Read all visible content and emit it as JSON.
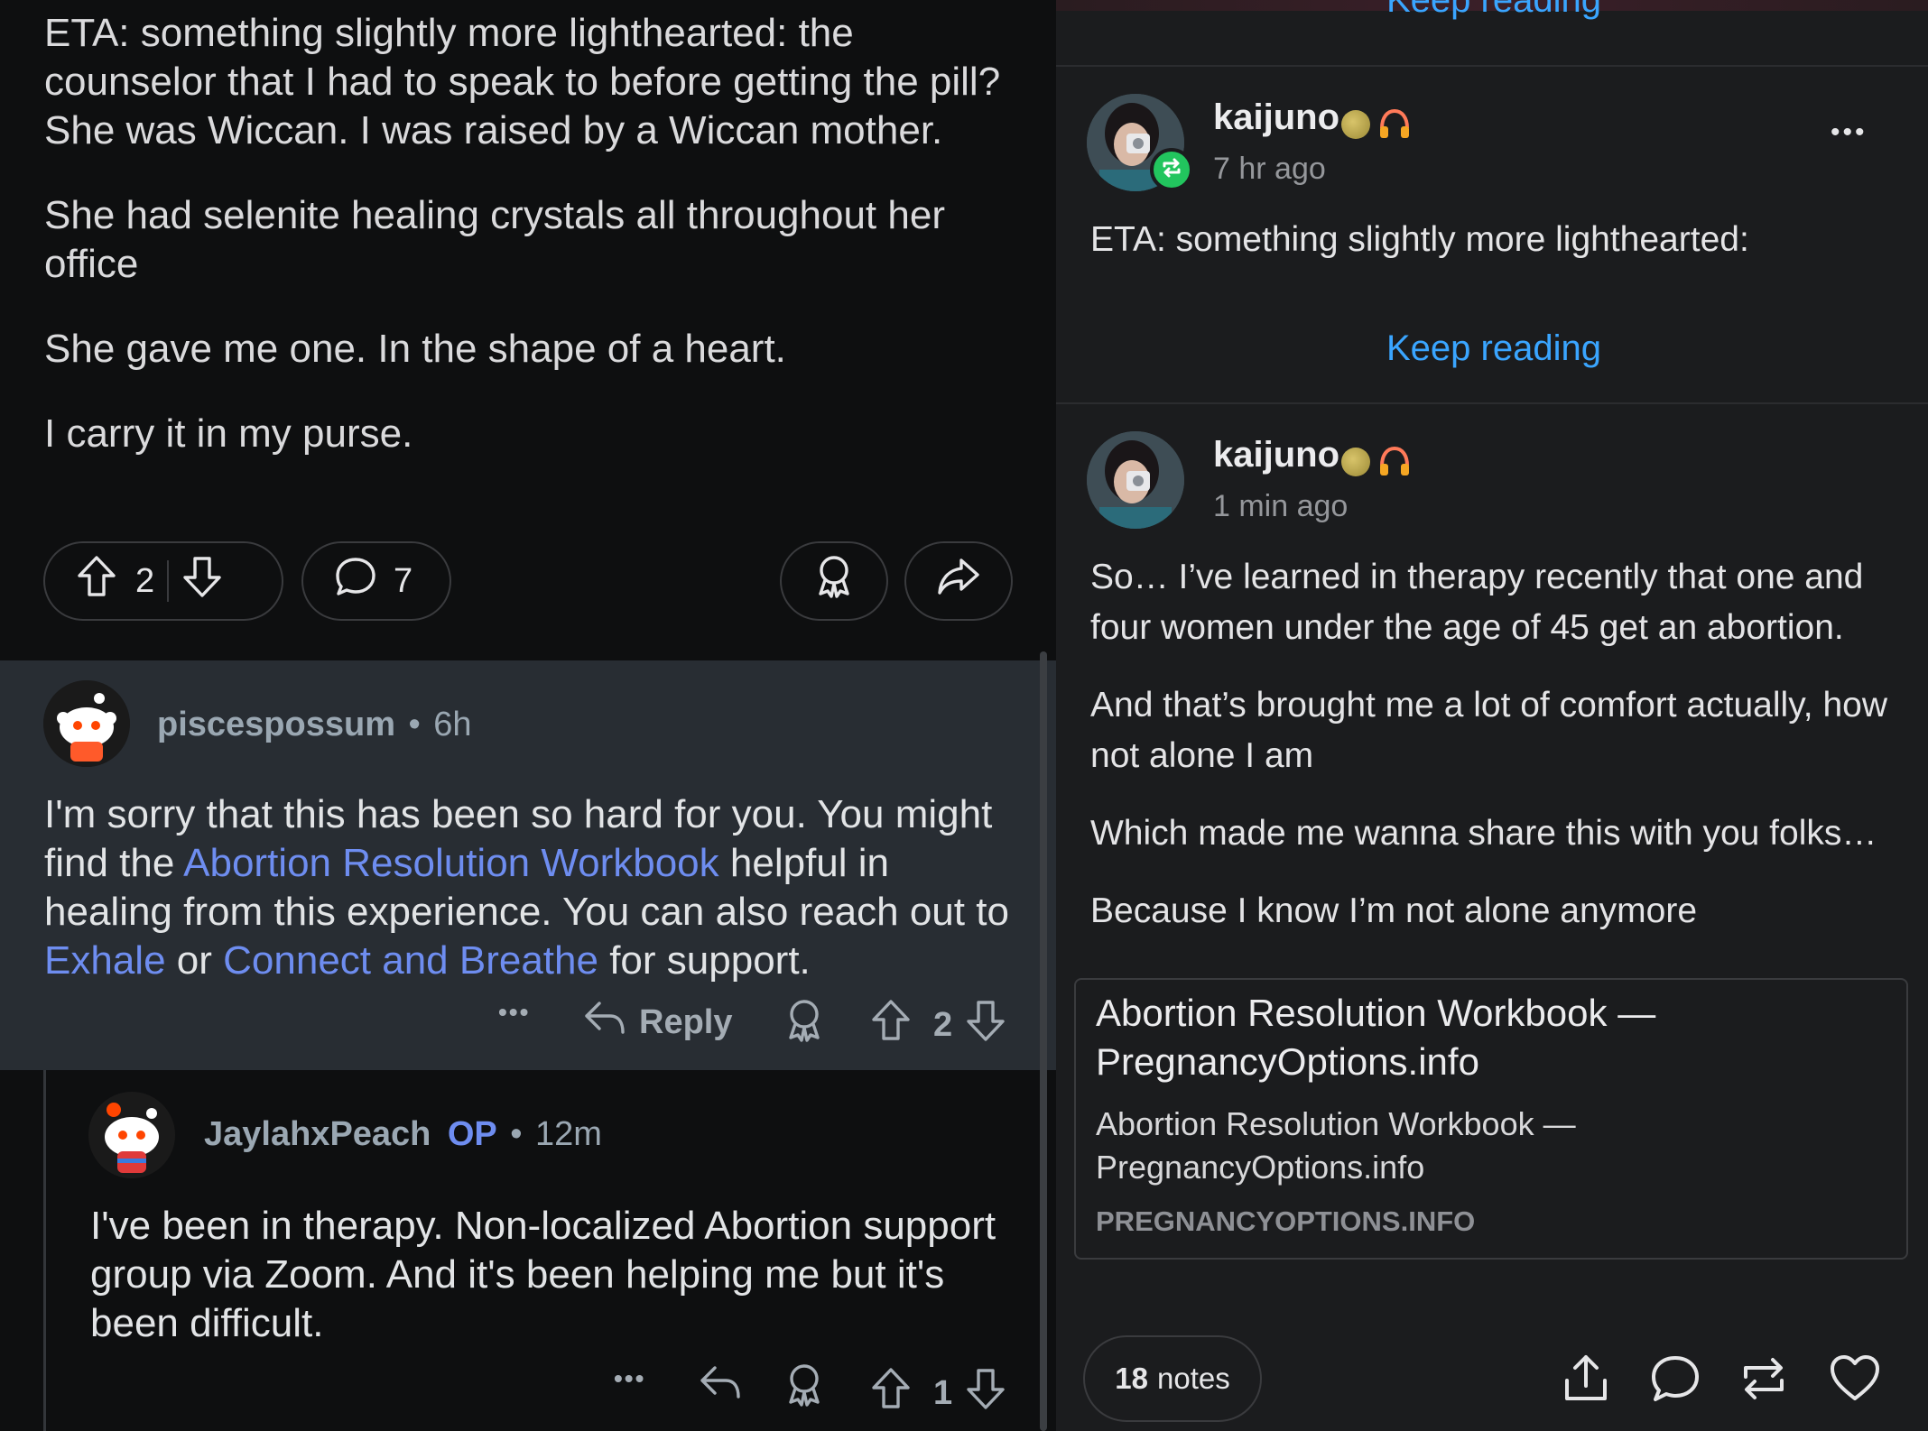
{
  "left": {
    "post_paragraphs": [
      "ETA: something slightly more lighthearted: the counselor that I had to speak to before getting the pill? She was Wiccan. I was raised by a Wiccan mother.",
      "She had selenite healing crystals all throughout her office",
      "She gave me one. In the shape of a heart.",
      "I carry it in my purse."
    ],
    "post_actions": {
      "votes": "2",
      "comments": "7"
    },
    "comment1": {
      "username": "piscespossum",
      "dot": "•",
      "time": "6h",
      "body_1": "I'm sorry that this has been so hard for you. You might find the ",
      "link_1": "Abortion Resolution Workbook",
      "body_2": " helpful in healing from this experience. You can also reach out to ",
      "link_2": "Exhale",
      "body_3": " or ",
      "link_3": "Connect and Breathe",
      "body_4": " for support.",
      "more": "•••",
      "reply_label": "Reply",
      "votes": "2"
    },
    "comment2": {
      "username": "JaylahxPeach",
      "op": "OP",
      "dot": "•",
      "time": "12m",
      "body": "I've been in therapy. Non-localized Abortion support group via Zoom. And it's been helping me but it's been difficult.",
      "more": "•••",
      "votes": "1"
    }
  },
  "right": {
    "keep_reading_top": "Keep reading",
    "post1": {
      "username": "kaijuno",
      "time": "7 hr ago",
      "body": "ETA: something slightly more lighthearted:",
      "keep_reading": "Keep reading",
      "more": "•••"
    },
    "post2": {
      "username": "kaijuno",
      "time": "1 min ago",
      "paragraphs": [
        "So… I’ve learned in therapy recently that one and four women under the age of 45 get an abortion.",
        "And that’s brought me a lot of comfort actually, how not alone I am",
        "Which made me wanna share this with you folks…",
        "Because I know I’m not alone anymore"
      ]
    },
    "link_card": {
      "title": "Abortion Resolution Workbook — PregnancyOptions.info",
      "subtitle": "Abortion Resolution Workbook — PregnancyOptions.info",
      "domain": "PREGNANCYOPTIONS.INFO"
    },
    "footer": {
      "notes_count": "18",
      "notes_label": "notes"
    }
  },
  "colors": {
    "link_blue": "#6e8df0",
    "tumblr_blue": "#3aa5ff",
    "reblog_green": "#22c55e"
  }
}
